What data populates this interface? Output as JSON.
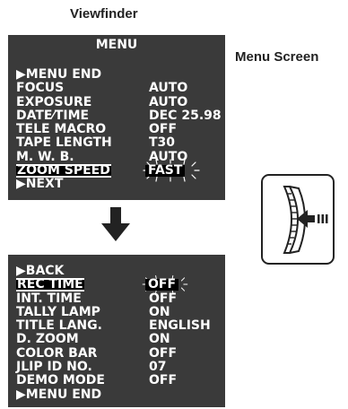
{
  "viewfinder_label": "Viewfinder",
  "menu_screen_label": "Menu Screen",
  "screen1": {
    "title": "MENU",
    "rows": [
      {
        "label": "▶MENU END",
        "value": ""
      },
      {
        "label": "FOCUS",
        "value": "AUTO"
      },
      {
        "label": "EXPOSURE",
        "value": "AUTO"
      },
      {
        "label": "DATE⁄TIME",
        "value": "DEC 25.98"
      },
      {
        "label": "TELE  MACRO",
        "value": "OFF"
      },
      {
        "label": "TAPE  LENGTH",
        "value": "T30"
      },
      {
        "label": "M. W. B.",
        "value": "AUTO"
      },
      {
        "label": "ZOOM  SPEED",
        "value": "FAST"
      },
      {
        "label": "▶NEXT",
        "value": ""
      }
    ]
  },
  "screen2": {
    "rows": [
      {
        "label": "▶BACK",
        "value": ""
      },
      {
        "label": "REC TIME",
        "value": "OFF"
      },
      {
        "label": "INT. TIME",
        "value": "OFF"
      },
      {
        "label": "TALLY LAMP",
        "value": "ON"
      },
      {
        "label": "TITLE LANG.",
        "value": "ENGLISH"
      },
      {
        "label": "D. ZOOM",
        "value": "ON"
      },
      {
        "label": "COLOR  BAR",
        "value": "OFF"
      },
      {
        "label": "JLIP ID NO.",
        "value": "07"
      },
      {
        "label": "DEMO  MODE",
        "value": "OFF"
      },
      {
        "label": "▶MENU  END",
        "value": ""
      }
    ]
  },
  "icons": [
    "down-arrow-icon",
    "menu-dial-icon",
    "press-arrow-icon"
  ]
}
